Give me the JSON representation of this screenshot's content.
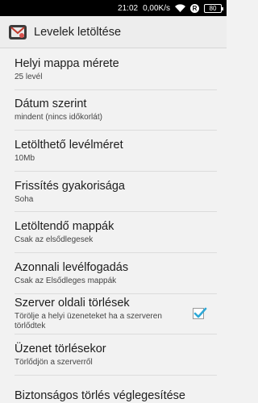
{
  "statusbar": {
    "time": "21:02",
    "speed": "0,00K/s",
    "r_badge": "R",
    "battery": "80"
  },
  "actionbar": {
    "title": "Levelek letöltése"
  },
  "prefs": [
    {
      "title": "Helyi mappa mérete",
      "summary": "25 levél"
    },
    {
      "title": "Dátum szerint",
      "summary": "mindent (nincs időkorlát)"
    },
    {
      "title": "Letölthető levélméret",
      "summary": "10Mb"
    },
    {
      "title": "Frissítés gyakorisága",
      "summary": "Soha"
    },
    {
      "title": "Letöltendő mappák",
      "summary": "Csak az elsődlegesek"
    },
    {
      "title": "Azonnali levélfogadás",
      "summary": "Csak az Elsődleges mappák"
    },
    {
      "title": "Szerver oldali törlések",
      "summary": "Törölje a helyi üzeneteket ha a szerveren törlődtek",
      "checked": true
    },
    {
      "title": "Üzenet törlésekor",
      "summary": "Törlődjön a szerverről"
    },
    {
      "title": "Biztonságos törlés véglegesítése",
      "summary": ""
    }
  ],
  "colors": {
    "checkbox_accent": "#2fa8d6"
  }
}
